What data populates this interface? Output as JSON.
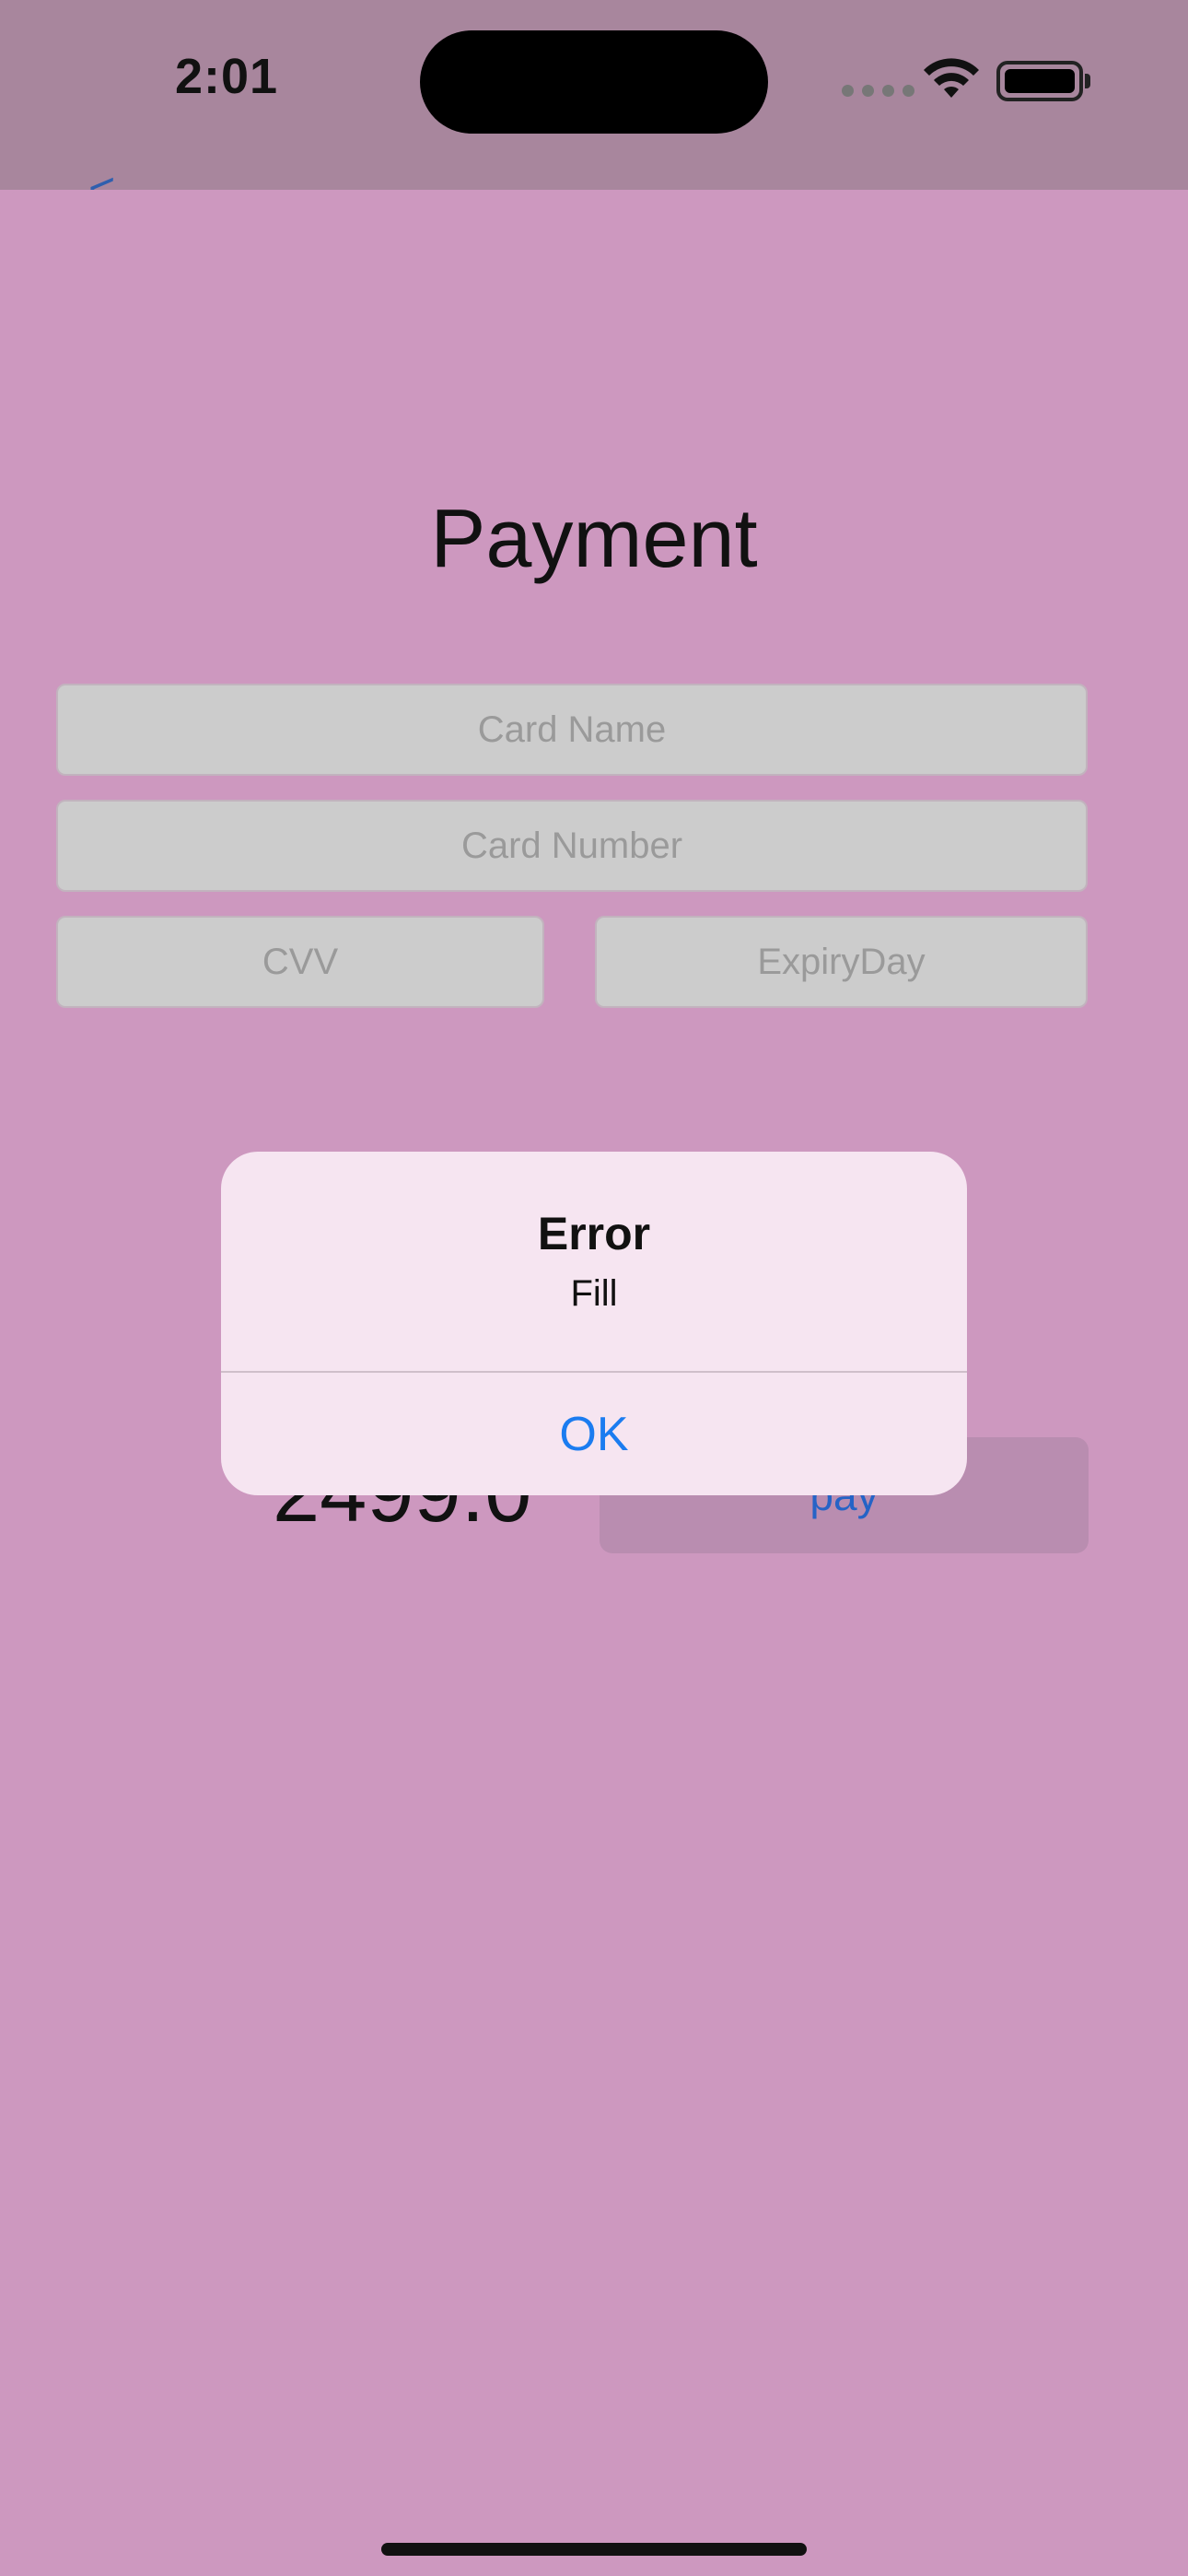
{
  "status_bar": {
    "time": "2:01"
  },
  "nav": {
    "back_label": "<"
  },
  "page": {
    "title": "Payment"
  },
  "form": {
    "card_name_placeholder": "Card Name",
    "card_number_placeholder": "Card Number",
    "cvv_placeholder": "CVV",
    "expiry_placeholder": "ExpiryDay"
  },
  "checkout": {
    "amount": "2499.0",
    "pay_label": "pay"
  },
  "alert": {
    "title": "Error",
    "message": "Fill",
    "ok_label": "OK"
  },
  "colors": {
    "background": "#cd98bf",
    "accent": "#1b7cf0",
    "field": "#cccccc",
    "alert_bg": "#f6e5f1"
  },
  "icons": [
    "wifi-icon",
    "battery-icon",
    "cellular-icon",
    "back-chevron-icon"
  ]
}
